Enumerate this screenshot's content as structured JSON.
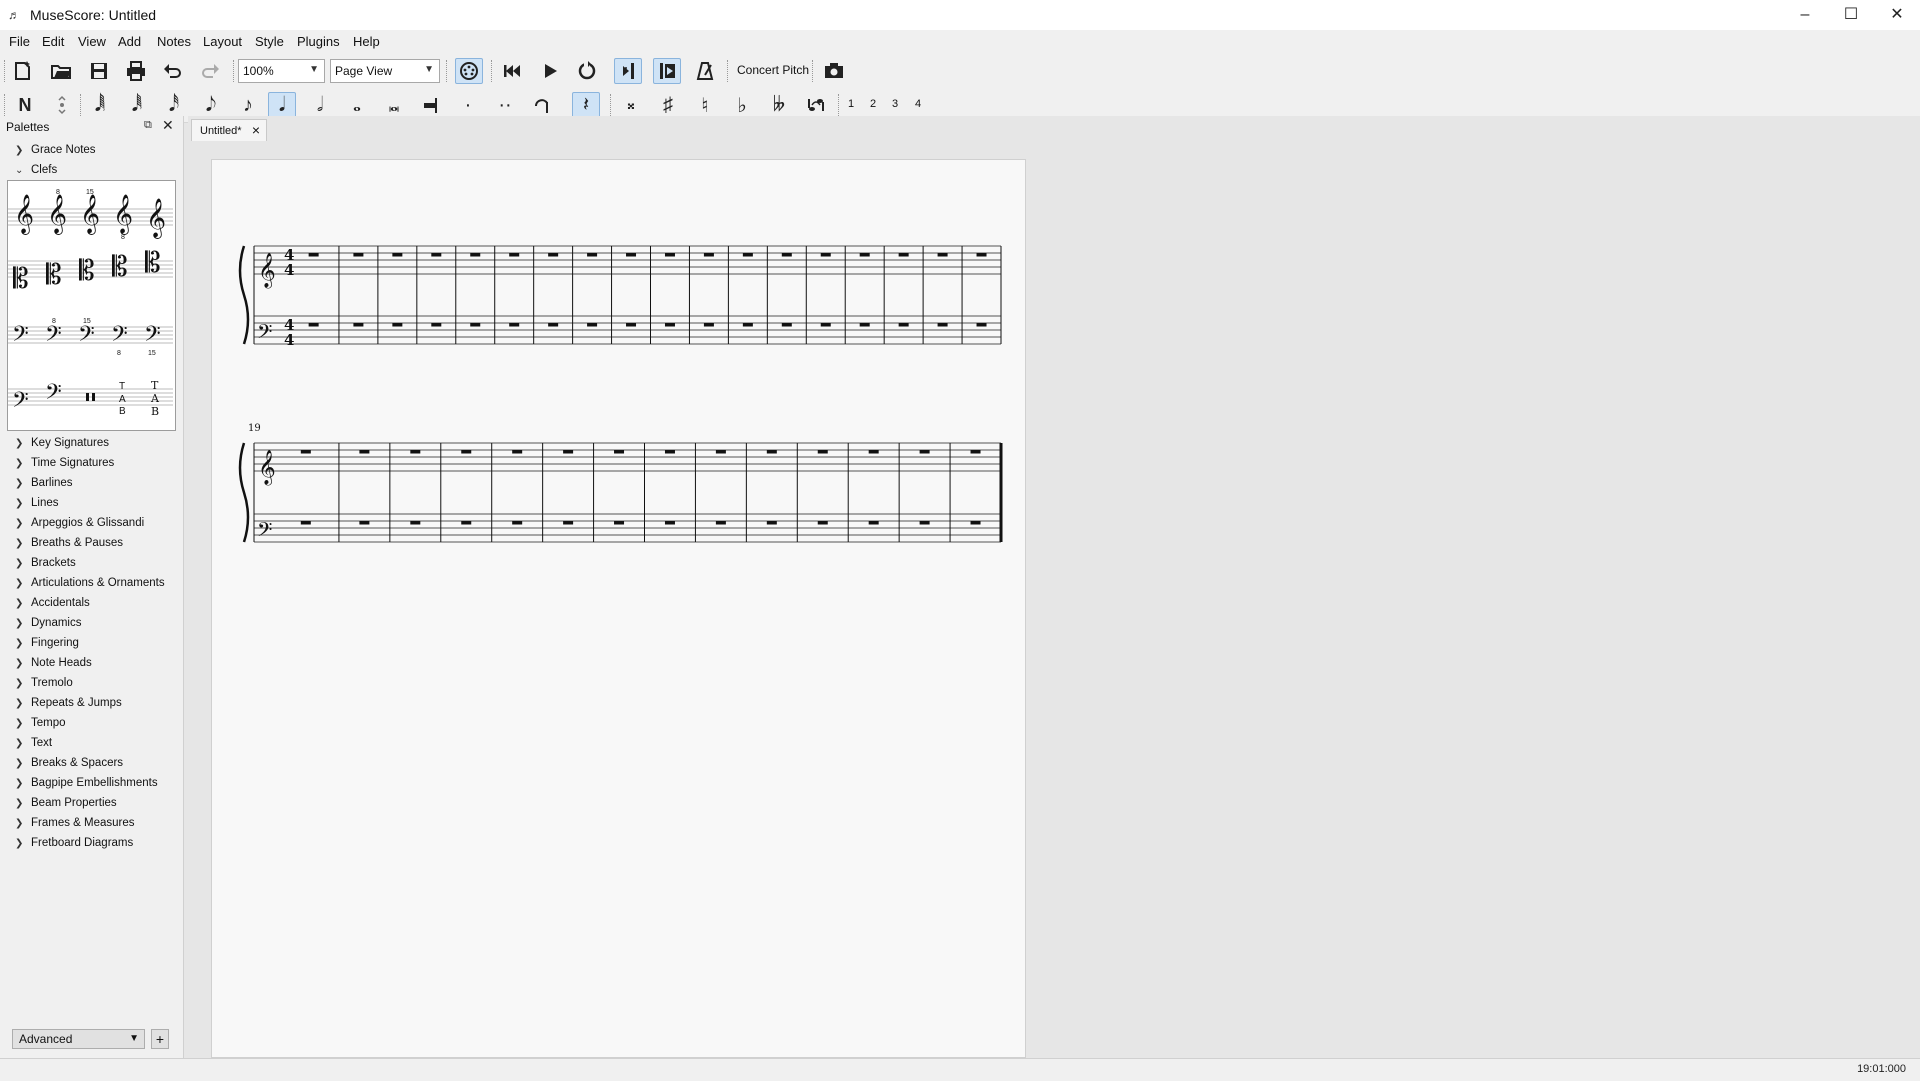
{
  "window": {
    "title": "MuseScore: Untitled"
  },
  "menu": [
    "File",
    "Edit",
    "View",
    "Add",
    "Notes",
    "Layout",
    "Style",
    "Plugins",
    "Help"
  ],
  "toolbar": {
    "zoom": "100%",
    "view_mode": "Page View",
    "concert_pitch": "Concert Pitch",
    "voices": [
      "1",
      "2",
      "3",
      "4"
    ]
  },
  "palettes": {
    "header": "Palettes",
    "sections_top": [
      "Grace Notes",
      "Clefs"
    ],
    "sections": [
      "Key Signatures",
      "Time Signatures",
      "Barlines",
      "Lines",
      "Arpeggios & Glissandi",
      "Breaths & Pauses",
      "Brackets",
      "Articulations & Ornaments",
      "Accidentals",
      "Dynamics",
      "Fingering",
      "Note Heads",
      "Tremolo",
      "Repeats & Jumps",
      "Tempo",
      "Text",
      "Breaks & Spacers",
      "Bagpipe Embellishments",
      "Beam Properties",
      "Frames & Measures",
      "Fretboard Diagrams"
    ],
    "workspace": "Advanced"
  },
  "score": {
    "tab_label": "Untitled*",
    "second_system_number": "19",
    "time_signature": [
      "4",
      "4"
    ]
  },
  "status": {
    "position": "19:01:000"
  },
  "colors": {
    "accent": "#8ab4dd",
    "page": "#f8f8f8",
    "chrome": "#f0f0f0",
    "canvas": "#e6e6e6"
  }
}
